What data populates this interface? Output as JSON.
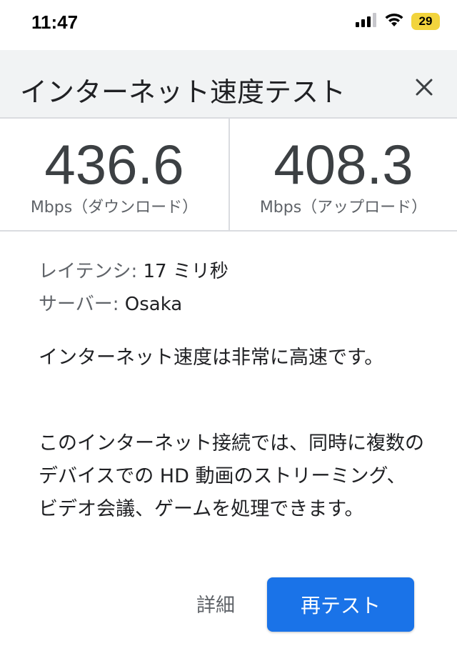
{
  "status_bar": {
    "time": "11:47",
    "battery_level": "29",
    "icons": [
      "cellular-signal-icon",
      "wifi-icon",
      "battery-icon"
    ],
    "battery_color": "#f2d43d"
  },
  "header": {
    "title": "インターネット速度テスト",
    "close_icon": "close-icon"
  },
  "results": {
    "download": {
      "value": "436.6",
      "unit": "Mbps（ダウンロード）"
    },
    "upload": {
      "value": "408.3",
      "unit": "Mbps（アップロード）"
    }
  },
  "info": {
    "latency_label": "レイテンシ:",
    "latency_value": "17 ミリ秒",
    "server_label": "サーバー:",
    "server_value": "Osaka"
  },
  "summary": {
    "speed_text": "インターネット速度は非常に高速です。",
    "description": "このインターネット接続では、同時に複数のデバイスでの HD 動画のストリーミング、ビデオ会議、ゲームを処理できます。"
  },
  "actions": {
    "details_label": "詳細",
    "retest_label": "再テスト"
  },
  "colors": {
    "accent": "#1a73e8",
    "header_bg": "#f1f3f4",
    "divider": "#dadce0"
  }
}
